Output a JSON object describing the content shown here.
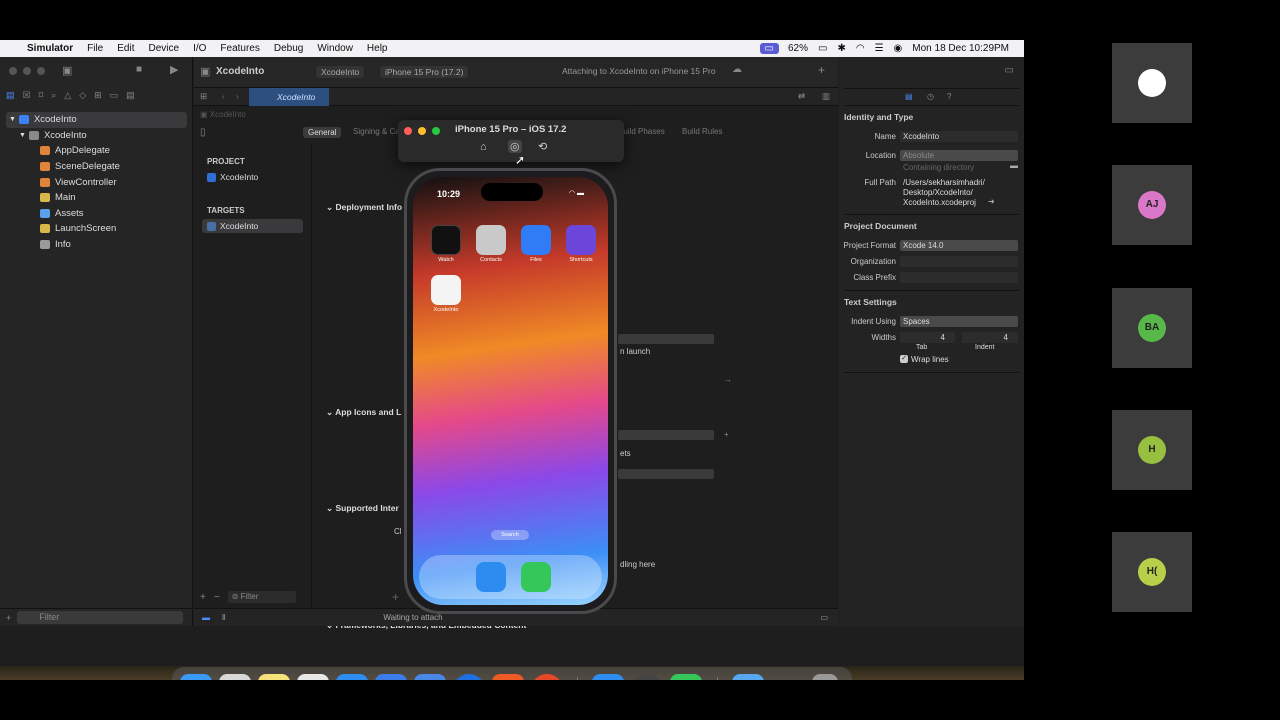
{
  "menubar": {
    "app_name": "Simulator",
    "items": [
      "File",
      "Edit",
      "Device",
      "I/O",
      "Features",
      "Debug",
      "Window",
      "Help"
    ],
    "battery": "62%",
    "datetime": "Mon 18 Dec  10:29PM"
  },
  "toolbar": {
    "scheme": "XcodeInto",
    "scheme_tab": "XcodeInto",
    "device": "iPhone 15 Pro (17.2)",
    "status": "Attaching to XcodeInto on iPhone 15 Pro"
  },
  "navigator": {
    "items": [
      {
        "label": "XcodeInto",
        "color": "#3b82f6"
      },
      {
        "label": "XcodeInto",
        "color": "#8a8a8a"
      },
      {
        "label": "AppDelegate",
        "color": "#e0843a"
      },
      {
        "label": "SceneDelegate",
        "color": "#e0843a"
      },
      {
        "label": "ViewController",
        "color": "#e0843a"
      },
      {
        "label": "Main",
        "color": "#d8b84a"
      },
      {
        "label": "Assets",
        "color": "#5aa0e8"
      },
      {
        "label": "LaunchScreen",
        "color": "#d8b84a"
      },
      {
        "label": "Info",
        "color": "#9a9a9a"
      }
    ],
    "filter_placeholder": "Filter"
  },
  "editor": {
    "breadcrumb": "XcodeInto",
    "tabs": [
      "General",
      "Signing & Capabi...",
      "Build Phases",
      "Build Rules"
    ],
    "project_header": "PROJECT",
    "project_item": "XcodeInto",
    "targets_header": "TARGETS",
    "target_item": "XcodeInto",
    "sections": [
      "Deployment Info",
      "App Icons and L",
      "Supported Inter",
      "Frameworks, Libraries, and Embedded Content"
    ],
    "fragments": [
      "n launch",
      "ets",
      "dling here",
      "Cl"
    ],
    "filter_placeholder": "Filter",
    "status": "Waiting to attach"
  },
  "inspector": {
    "identity_header": "Identity and Type",
    "name_label": "Name",
    "name_value": "XcodeInto",
    "location_label": "Location",
    "location_value": "Absolute",
    "containing_dir": "Containing directory",
    "fullpath_label": "Full Path",
    "fullpath_lines": [
      "/Users/sekharsimhadri/",
      "Desktop/XcodeInto/",
      "XcodeInto.xcodeproj"
    ],
    "projdoc_header": "Project Document",
    "format_label": "Project Format",
    "format_value": "Xcode 14.0",
    "org_label": "Organization",
    "prefix_label": "Class Prefix",
    "text_header": "Text Settings",
    "indent_label": "Indent Using",
    "indent_value": "Spaces",
    "widths_label": "Widths",
    "tab_value": "4",
    "indent_width_value": "4",
    "tab_caption": "Tab",
    "indent_caption": "Indent",
    "wrap_label": "Wrap lines"
  },
  "simulator": {
    "title": "iPhone 15 Pro – iOS 17.2",
    "time": "10:29",
    "apps": [
      {
        "label": "Watch",
        "color": "#111"
      },
      {
        "label": "Contacts",
        "color": "#c9c9c9"
      },
      {
        "label": "Files",
        "color": "#2f7cf6"
      },
      {
        "label": "Shortcuts",
        "color": "#6b46d8"
      },
      {
        "label": "XcodeInto",
        "color": "#f4f4f4"
      }
    ],
    "search": "Search",
    "dock_apps": [
      {
        "name": "Safari",
        "color": "#2e8cf0"
      },
      {
        "name": "Messages",
        "color": "#34c759"
      }
    ]
  },
  "dock": [
    {
      "name": "Finder",
      "color": "#3a9af5"
    },
    {
      "name": "Launchpad",
      "color": "#d8d8d8"
    },
    {
      "name": "Notes",
      "color": "#f6e27a"
    },
    {
      "name": "Chrome",
      "color": "#e8e8e8"
    },
    {
      "name": "Safari",
      "color": "#2f8df2"
    },
    {
      "name": "Xcode",
      "color": "#3c7ce8"
    },
    {
      "name": "Simulator",
      "color": "#4a88e8"
    },
    {
      "name": "Maps Pin",
      "color": "#1e6fe0"
    },
    {
      "name": "Brave",
      "color": "#f05a24"
    },
    {
      "name": "JioMeet",
      "color": "#e8482a"
    },
    {
      "name": "App Store",
      "color": "#2e8cf2"
    },
    {
      "name": "QuickTime",
      "color": "#444"
    },
    {
      "name": "FaceTime",
      "color": "#35c759"
    },
    {
      "name": "Downloads",
      "color": "#57a8f0"
    },
    {
      "name": "Preview",
      "color": "#f0f0f0"
    },
    {
      "name": "Trash",
      "color": "#999"
    }
  ],
  "participants": [
    {
      "initials": "",
      "color": "#ffffff"
    },
    {
      "initials": "AJ",
      "color": "#d978c8"
    },
    {
      "initials": "BA",
      "color": "#58b84a"
    },
    {
      "initials": "H",
      "color": "#98c040"
    },
    {
      "initials": "H(",
      "color": "#b6d04a"
    }
  ]
}
